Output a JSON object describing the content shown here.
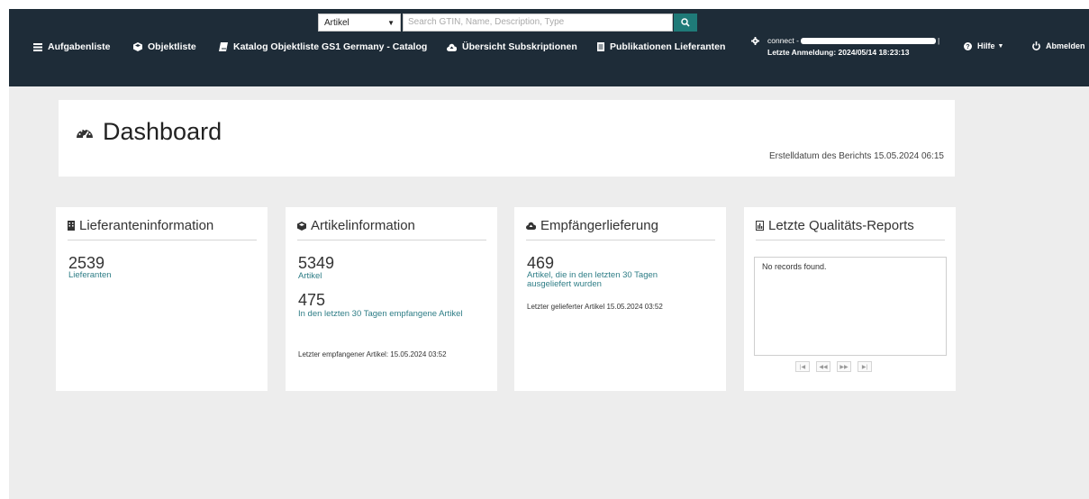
{
  "search": {
    "type_selected": "Artikel",
    "placeholder": "Search GTIN, Name, Description, Type"
  },
  "nav": {
    "items": [
      {
        "label": "Aufgabenliste",
        "icon": "list-icon"
      },
      {
        "label": "Objektliste",
        "icon": "cube-icon"
      },
      {
        "label": "Katalog Objektliste GS1 Germany - Catalog",
        "icon": "book-icon"
      },
      {
        "label": "Übersicht Subskriptionen",
        "icon": "cloud-upload-icon"
      },
      {
        "label": "Publikationen Lieferanten",
        "icon": "document-icon"
      }
    ],
    "user_prefix": "connect -",
    "last_login": "Letzte Anmeldung: 2024/05/14 18:23:13",
    "help_label": "Hilfe",
    "logout_label": "Abmelden"
  },
  "dashboard": {
    "title": "Dashboard",
    "report_date": "Erstelldatum des Berichts 15.05.2024 06:15"
  },
  "cards": {
    "supplier": {
      "title": "Lieferanteninformation",
      "count": "2539",
      "count_label": "Lieferanten"
    },
    "article": {
      "title": "Artikelinformation",
      "count": "5349",
      "count_label": "Artikel",
      "recent_count": "475",
      "recent_label": "In den letzten 30 Tagen empfangene Artikel",
      "last_received": "Letzter empfangener Artikel: 15.05.2024 03:52"
    },
    "delivery": {
      "title": "Empfängerlieferung",
      "count": "469",
      "count_label": "Artikel, die in den letzten 30 Tagen ausgeliefert wurden",
      "last_delivered": "Letzter gelieferter Artikel 15.05.2024 03:52"
    },
    "quality": {
      "title": "Letzte Qualitäts-Reports",
      "empty_text": "No records found."
    }
  }
}
